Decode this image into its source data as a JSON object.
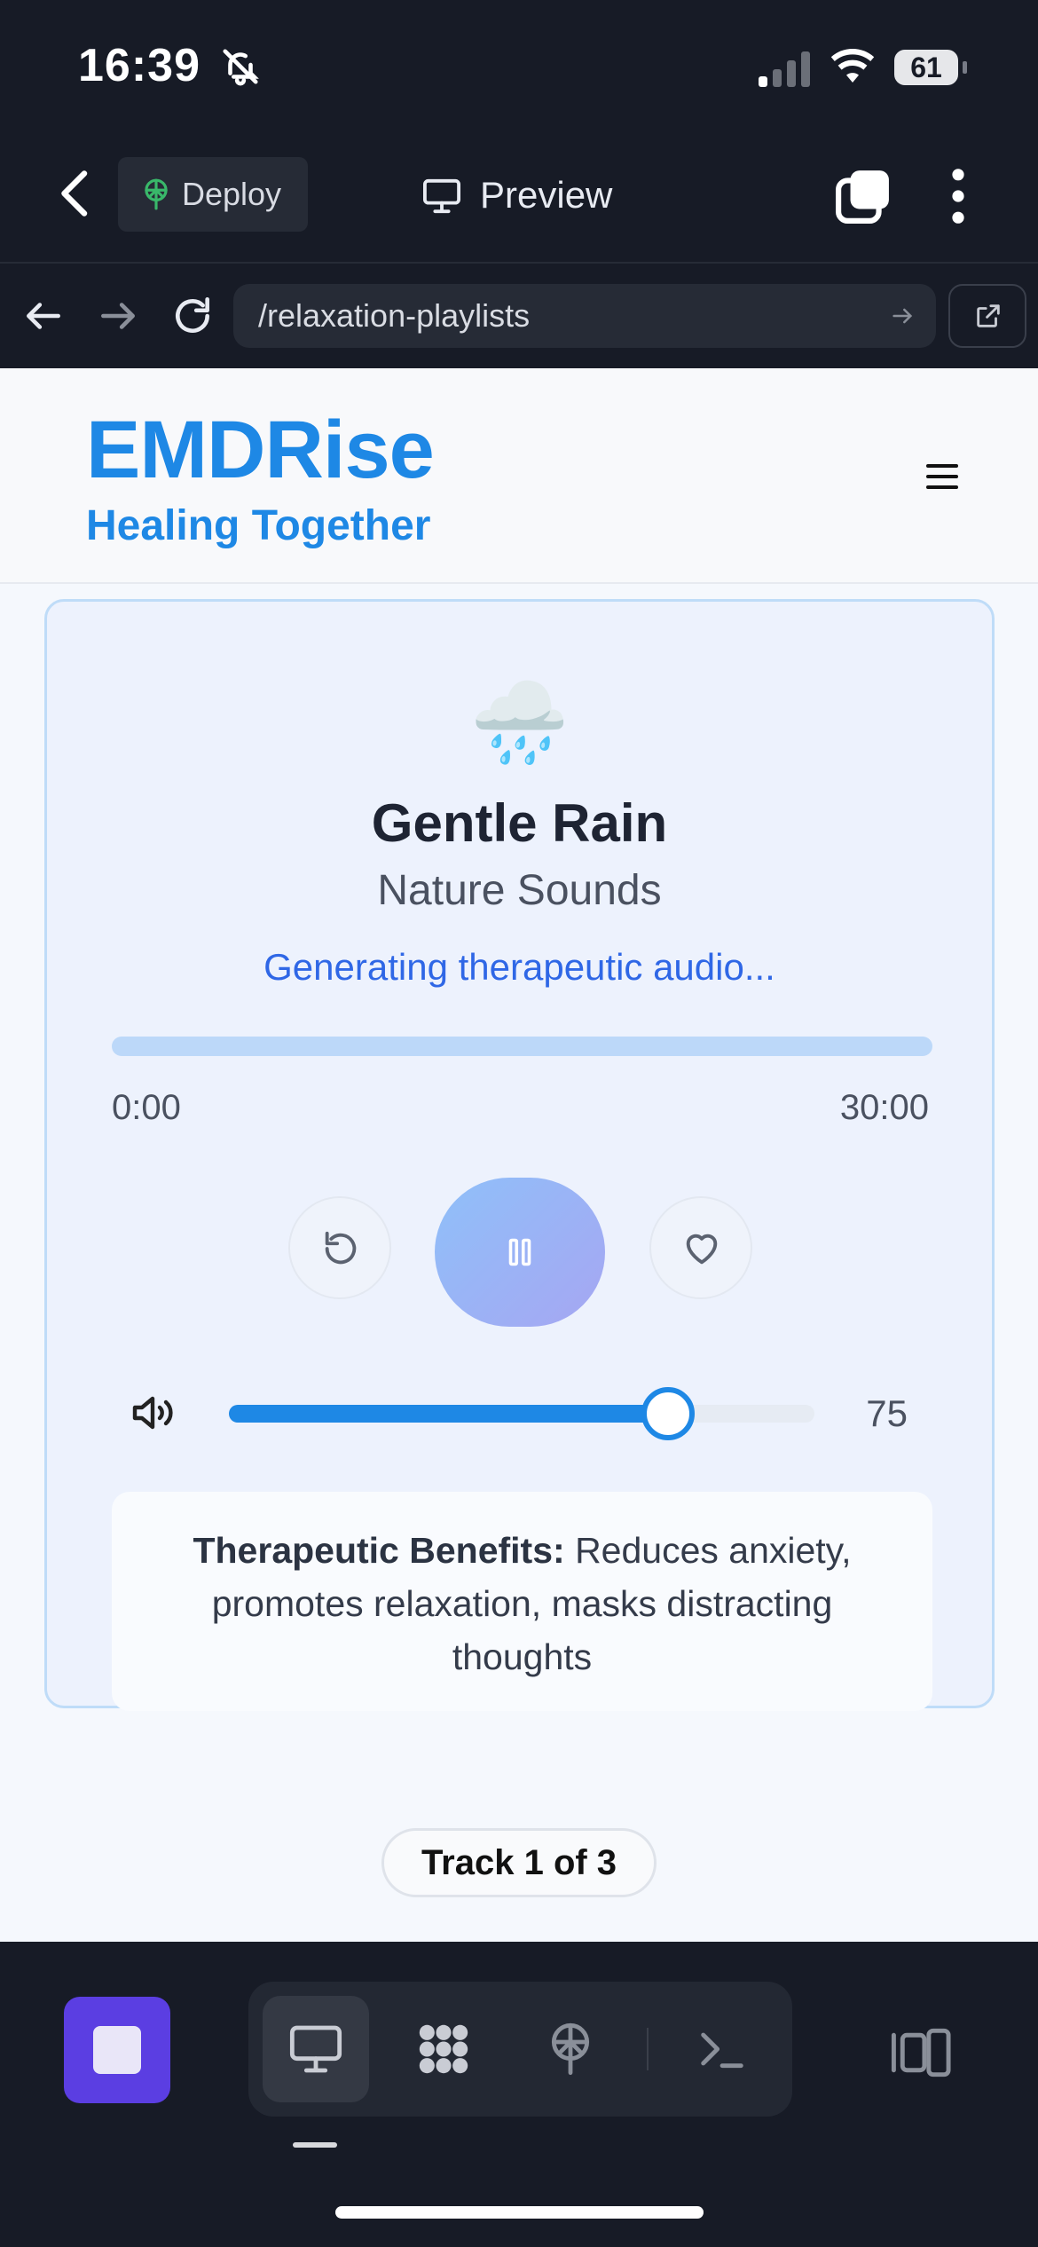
{
  "status_bar": {
    "time": "16:39",
    "battery": "61"
  },
  "app_bar": {
    "deploy_label": "Deploy",
    "preview_label": "Preview"
  },
  "browser": {
    "url": "/relaxation-playlists"
  },
  "site": {
    "logo": "EMDRise",
    "tagline": "Healing Together"
  },
  "player": {
    "icon": "🌧️",
    "title": "Gentle Rain",
    "category": "Nature Sounds",
    "status": "Generating therapeutic audio...",
    "progress_fraction": 0,
    "current_time": "0:00",
    "total_time": "30:00",
    "volume": "75",
    "volume_fraction": 0.75,
    "benefits_label": "Therapeutic Benefits:",
    "benefits_text": " Reduces anxiety, promotes relaxation, masks distracting thoughts"
  },
  "track_indicator": "Track 1 of 3",
  "colors": {
    "accent": "#1e88e5",
    "dock_stop": "#5b3ee2",
    "status_text": "#2f67e6"
  },
  "icons": [
    "bell-slash-icon",
    "signal-icon",
    "wifi-icon",
    "back-chevron-icon",
    "deploy-icon",
    "monitor-icon",
    "tabs-icon",
    "more-vertical-icon",
    "arrow-left-icon",
    "arrow-right-icon",
    "reload-icon",
    "external-link-icon",
    "hamburger-icon",
    "rain-cloud-icon",
    "restart-icon",
    "pause-icon",
    "heart-icon",
    "volume-icon",
    "stop-icon",
    "preview-icon",
    "grid-icon",
    "deploy-antenna-icon",
    "terminal-icon",
    "layout-icon"
  ]
}
